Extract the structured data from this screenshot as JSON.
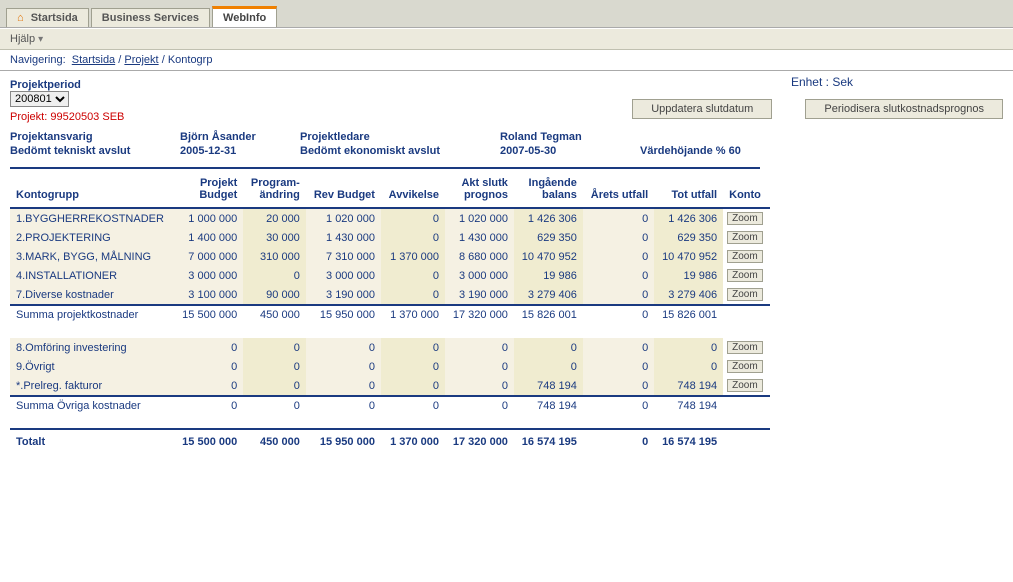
{
  "tabs": {
    "startsida": "Startsida",
    "business": "Business Services",
    "webinfo": "WebInfo"
  },
  "help": {
    "label": "Hjälp"
  },
  "nav": {
    "label": "Navigering:",
    "crumb1": "Startsida",
    "crumb2": "Projekt",
    "current": "Kontogrp"
  },
  "period": {
    "label": "Projektperiod",
    "value": "200801"
  },
  "enhet": {
    "label": "Enhet :",
    "value": "Sek"
  },
  "projekt": {
    "label": "Projekt:",
    "value": "99520503 SEB"
  },
  "buttons": {
    "uppdatera": "Uppdatera slutdatum",
    "periodisera": "Periodisera slutkostnadsprognos"
  },
  "meta": {
    "projektansvarig_lbl": "Projektansvarig",
    "projektansvarig_val": "Björn Åsander",
    "projektledare_lbl": "Projektledare",
    "projektledare_val": "Roland Tegman",
    "tekniskt_lbl": "Bedömt tekniskt avslut",
    "tekniskt_val": "2005-12-31",
    "ekonomiskt_lbl": "Bedömt ekonomiskt avslut",
    "ekonomiskt_val": "2007-05-30",
    "varde_lbl": "Värdehöjande %",
    "varde_val": "60"
  },
  "columns": {
    "kontogrupp": "Kontogrupp",
    "projektbudget": "Projekt\nBudget",
    "programandring": "Program-\nändring",
    "revbudget": "Rev Budget",
    "avvikelse": "Avvikelse",
    "aktslutk": "Akt slutk\nprognos",
    "ingaende": "Ingående\nbalans",
    "aretsutfall": "Årets utfall",
    "totutfall": "Tot utfall",
    "konto": "Konto"
  },
  "zoom_label": "Zoom",
  "section1": {
    "rows": [
      {
        "name": "1.BYGGHERREKOSTNADER",
        "v": [
          "1 000 000",
          "20 000",
          "1 020 000",
          "0",
          "1 020 000",
          "1 426 306",
          "0",
          "1 426 306"
        ]
      },
      {
        "name": "2.PROJEKTERING",
        "v": [
          "1 400 000",
          "30 000",
          "1 430 000",
          "0",
          "1 430 000",
          "629 350",
          "0",
          "629 350"
        ]
      },
      {
        "name": "3.MARK, BYGG, MÅLNING",
        "v": [
          "7 000 000",
          "310 000",
          "7 310 000",
          "1 370 000",
          "8 680 000",
          "10 470 952",
          "0",
          "10 470 952"
        ]
      },
      {
        "name": "4.INSTALLATIONER",
        "v": [
          "3 000 000",
          "0",
          "3 000 000",
          "0",
          "3 000 000",
          "19 986",
          "0",
          "19 986"
        ]
      },
      {
        "name": "7.Diverse kostnader",
        "v": [
          "3 100 000",
          "90 000",
          "3 190 000",
          "0",
          "3 190 000",
          "3 279 406",
          "0",
          "3 279 406"
        ]
      }
    ],
    "sum": {
      "name": "Summa projektkostnader",
      "v": [
        "15 500 000",
        "450 000",
        "15 950 000",
        "1 370 000",
        "17 320 000",
        "15 826 001",
        "0",
        "15 826 001"
      ]
    }
  },
  "section2": {
    "rows": [
      {
        "name": "8.Omföring investering",
        "v": [
          "0",
          "0",
          "0",
          "0",
          "0",
          "0",
          "0",
          "0"
        ]
      },
      {
        "name": "9.Övrigt",
        "v": [
          "0",
          "0",
          "0",
          "0",
          "0",
          "0",
          "0",
          "0"
        ]
      },
      {
        "name": "*.Prelreg. fakturor",
        "v": [
          "0",
          "0",
          "0",
          "0",
          "0",
          "748 194",
          "0",
          "748 194"
        ]
      }
    ],
    "sum": {
      "name": "Summa Övriga kostnader",
      "v": [
        "0",
        "0",
        "0",
        "0",
        "0",
        "748 194",
        "0",
        "748 194"
      ]
    }
  },
  "total": {
    "name": "Totalt",
    "v": [
      "15 500 000",
      "450 000",
      "15 950 000",
      "1 370 000",
      "17 320 000",
      "16 574 195",
      "0",
      "16 574 195"
    ]
  }
}
